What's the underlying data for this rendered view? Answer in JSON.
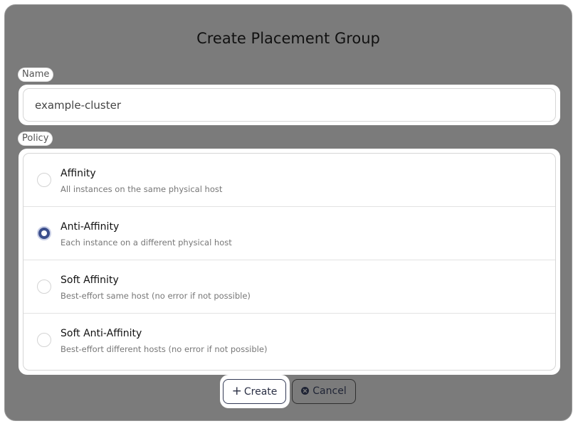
{
  "dialog": {
    "title": "Create Placement Group"
  },
  "name_field": {
    "label": "Name",
    "value": "example-cluster",
    "placeholder": ""
  },
  "policy_field": {
    "label": "Policy",
    "selected": "Anti-Affinity",
    "options": [
      {
        "title": "Affinity",
        "description": "All instances on the same physical host",
        "checked": false
      },
      {
        "title": "Anti-Affinity",
        "description": "Each instance on a different physical host",
        "checked": true
      },
      {
        "title": "Soft Affinity",
        "description": "Best-effort same host (no error if not possible)",
        "checked": false
      },
      {
        "title": "Soft Anti-Affinity",
        "description": "Best-effort different hosts (no error if not possible)",
        "checked": false
      }
    ]
  },
  "actions": {
    "create_label": "Create",
    "create_icon": "plus-icon",
    "cancel_label": "Cancel",
    "cancel_icon": "x-circle-icon"
  },
  "colors": {
    "overlay": "#7b7b7b",
    "accent": "#3b4e8c",
    "surface": "#ffffff"
  }
}
